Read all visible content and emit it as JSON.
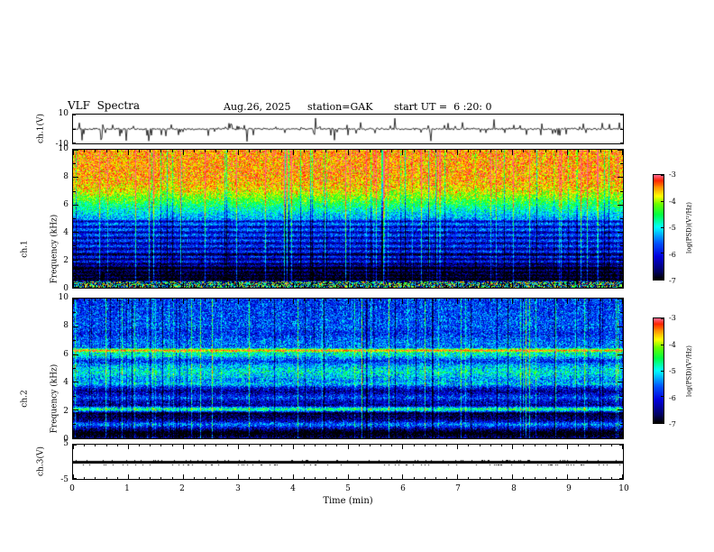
{
  "header": {
    "title": "VLF  Spectra",
    "date": "Aug.26, 2025",
    "station": "station=GAK",
    "start_ut": "start UT =  6 :20: 0"
  },
  "xaxis": {
    "label": "Time (min)",
    "lim": [
      0,
      10
    ],
    "ticks": [
      "0",
      "1",
      "2",
      "3",
      "4",
      "5",
      "6",
      "7",
      "8",
      "9",
      "10"
    ]
  },
  "colormap": [
    [
      0.0,
      "#000000"
    ],
    [
      0.08,
      "#000066"
    ],
    [
      0.22,
      "#0000dd"
    ],
    [
      0.35,
      "#0055ff"
    ],
    [
      0.5,
      "#00ffff"
    ],
    [
      0.62,
      "#00ff44"
    ],
    [
      0.72,
      "#66ff00"
    ],
    [
      0.8,
      "#ffff00"
    ],
    [
      0.88,
      "#ff9900"
    ],
    [
      0.95,
      "#ff2200"
    ],
    [
      1.0,
      "#ff6688"
    ]
  ],
  "colorbars": [
    {
      "label": "log(PSD)(V²/Hz)",
      "ticks": [
        "-3",
        "-4",
        "-5",
        "-6",
        "-7"
      ],
      "lim": [
        -3,
        -7
      ]
    },
    {
      "label": "log(PSD)(V²/Hz)",
      "ticks": [
        "-3",
        "-4",
        "-5",
        "-6",
        "-7"
      ],
      "lim": [
        -3,
        -7
      ]
    }
  ],
  "chart_data": [
    {
      "id": "ch1_waveform",
      "type": "line",
      "ylabel": "ch.1(V)",
      "ylim": [
        -10,
        10
      ],
      "yticks": [
        10,
        -10
      ],
      "description": "broadband noisy voltage trace near 0 V with frequent impulsive spikes up to about ±9 V across the full 10 minutes",
      "signal": {
        "noise_v": 0.7,
        "spike_prob_large": 0.03,
        "spike_prob_small": 0.1,
        "spike_vmax": 9
      }
    },
    {
      "id": "ch1_spectrogram",
      "type": "heatmap",
      "ylabel": "ch.1",
      "ylabel2": "Frequency (kHz)",
      "ylim": [
        0,
        10
      ],
      "yticks": [
        10,
        8,
        6,
        4,
        2,
        0
      ],
      "zlim": [
        -7,
        -3
      ],
      "description": "intense red/orange PSD above ~7 kHz fading through green near 5-6 kHz to blue below 5 kHz, with many thin dark horizontal interference lines between 0.5-5 kHz, dense vertical sferic streaks, and a noisy mixed strip below 0.5 kHz",
      "profile": [
        [
          0,
          -6.1
        ],
        [
          0.5,
          -6.4
        ],
        [
          1,
          -6.3
        ],
        [
          2,
          -5.9
        ],
        [
          3,
          -5.75
        ],
        [
          4.5,
          -5.55
        ],
        [
          5.2,
          -5.2
        ],
        [
          6,
          -4.6
        ],
        [
          6.6,
          -4.1
        ],
        [
          7.2,
          -3.7
        ],
        [
          8,
          -3.5
        ],
        [
          10,
          -3.45
        ]
      ],
      "bands": [
        [
          4.8,
          -0.9,
          0.09
        ],
        [
          4.4,
          -0.9,
          0.09
        ],
        [
          4.0,
          -0.9,
          0.09
        ],
        [
          3.6,
          -0.9,
          0.09
        ],
        [
          3.2,
          -0.9,
          0.09
        ],
        [
          2.8,
          -0.9,
          0.09
        ],
        [
          2.4,
          -1.3,
          0.1
        ],
        [
          2.05,
          -0.9,
          0.09
        ],
        [
          1.7,
          -0.9,
          0.09
        ],
        [
          1.4,
          -1.3,
          0.12
        ],
        [
          1.1,
          -1.0,
          0.1
        ],
        [
          0.85,
          -1.0,
          0.1
        ],
        [
          0.6,
          -1.0,
          0.1
        ]
      ],
      "bottom_mix_khz": 0.45,
      "noise": 0.5,
      "streak_bright_prob": 0.07,
      "streak_dark_prob": 0.045
    },
    {
      "id": "ch2_spectrogram",
      "type": "heatmap",
      "ylabel": "ch.2",
      "ylabel2": "Frequency (kHz)",
      "ylim": [
        0,
        10
      ],
      "yticks": [
        10,
        8,
        6,
        4,
        2,
        0
      ],
      "zlim": [
        -7,
        -3
      ],
      "description": "mostly blue/cyan/green speckled PSD with a strong yellow-red horizontal line near 6.3 kHz, a yellowish band near 2 kHz, green patches near 4-5 kHz, dark horizontal bands near 1.5 and 3.3 kHz and below 0.6 kHz, plus vertical bright and dark streaks",
      "profile": [
        [
          0,
          -6.3
        ],
        [
          0.5,
          -6.0
        ],
        [
          1,
          -5.8
        ],
        [
          2,
          -5.6
        ],
        [
          3,
          -5.65
        ],
        [
          4,
          -5.5
        ],
        [
          5,
          -5.45
        ],
        [
          6,
          -5.5
        ],
        [
          7,
          -5.55
        ],
        [
          8,
          -5.65
        ],
        [
          10,
          -5.8
        ]
      ],
      "bands": [
        [
          6.3,
          2.2,
          0.12
        ],
        [
          6.0,
          0.7,
          0.2
        ],
        [
          2.05,
          1.2,
          0.12
        ],
        [
          4.75,
          0.55,
          0.45
        ],
        [
          1.0,
          0.5,
          0.12
        ],
        [
          3.9,
          0.4,
          0.15
        ],
        [
          3.35,
          -0.9,
          0.3
        ],
        [
          2.6,
          -0.7,
          0.18
        ],
        [
          2.35,
          -0.8,
          0.1
        ],
        [
          1.75,
          -0.8,
          0.1
        ],
        [
          1.5,
          -1.1,
          0.35
        ],
        [
          0.35,
          -1.3,
          0.3
        ],
        [
          5.5,
          -0.4,
          0.15
        ],
        [
          7.5,
          -0.3,
          0.3
        ]
      ],
      "bottom_mix_khz": 0,
      "noise": 0.6,
      "streak_bright_prob": 0.06,
      "streak_dark_prob": 0.05
    },
    {
      "id": "ch3_line",
      "type": "line",
      "ylabel": "ch.3(V)",
      "ylim": [
        -5,
        5
      ],
      "yticks": [
        5,
        -5
      ],
      "description": "flat dark trace at 0 V for the whole record",
      "signal": {
        "flat_value": 0
      }
    }
  ]
}
